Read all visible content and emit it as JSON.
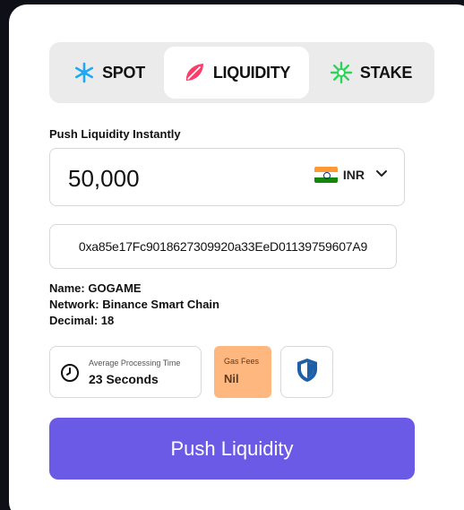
{
  "tabs": [
    {
      "label": "SPOT",
      "icon": "snowflake-icon",
      "active": false
    },
    {
      "label": "LIQUIDITY",
      "icon": "leaf-icon",
      "active": true
    },
    {
      "label": "STAKE",
      "icon": "sparkle-icon",
      "active": false
    }
  ],
  "amount": {
    "label": "Push Liquidity Instantly",
    "value": "50,000",
    "currency": "INR",
    "currency_flag": "india-flag-icon"
  },
  "address": "0xa85e17Fc9018627309920a33EeD01139759607A9",
  "token": {
    "name_line": "Name: GOGAME",
    "network_line": "Network: Binance Smart Chain",
    "decimal_line": "Decimal: 18"
  },
  "processing": {
    "label": "Average Processing Time",
    "value": "23 Seconds"
  },
  "gas": {
    "label": "Gas Fees",
    "value": "Nil"
  },
  "action": {
    "label": "Push Liquidity"
  },
  "colors": {
    "accent": "#6a5ae6",
    "spot_icon": "#1fa9f4",
    "liquidity_icon": "#ff3d6b",
    "stake_icon": "#2fd35a",
    "gas_bg": "#ffb780",
    "shield": "#1e5fa8"
  }
}
